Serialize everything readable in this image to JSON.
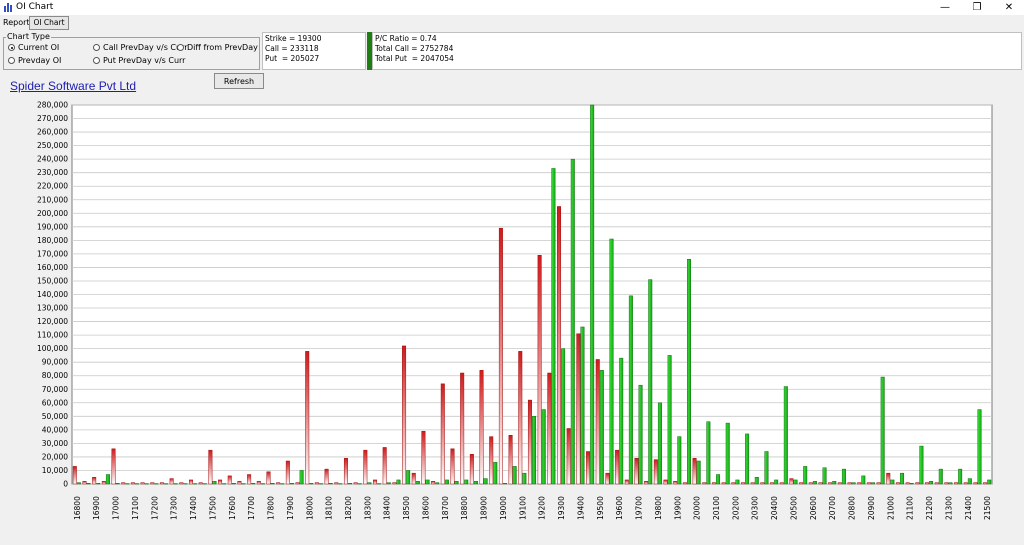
{
  "window": {
    "title": "OI Chart",
    "minimize": "—",
    "restore": "❐",
    "close": "✕"
  },
  "tabs": {
    "report": "Report",
    "oi_chart": "OI Chart"
  },
  "chart_type": {
    "legend": "Chart Type",
    "options": [
      "Current OI",
      "Prevday OI",
      "Call PrevDay v/s Curr",
      "Put PrevDay v/s Curr",
      "Diff from PrevDay"
    ],
    "selected": "Current OI"
  },
  "info_strike": {
    "strike": "Strike = 19300",
    "call": "Call = 233118",
    "put": "Put  = 205027"
  },
  "info_totals": {
    "pc_ratio": "P/C Ratio = 0.74",
    "total_call": "Total Call = 2752784",
    "total_put": "Total Put  = 2047054"
  },
  "refresh_label": "Refresh",
  "company_link": "Spider Software Pvt Ltd",
  "colors": {
    "call": "#22d322",
    "put": "#d42020",
    "plot_bg": "#ffffff",
    "grid": "#c8c8c8"
  },
  "chart_data": {
    "type": "bar",
    "title": "",
    "xlabel": "",
    "ylabel": "",
    "ylim": [
      0,
      280000
    ],
    "ytick_step": 10000,
    "grid": true,
    "categories": [
      "16800",
      "16850",
      "16900",
      "16950",
      "17000",
      "17050",
      "17100",
      "17150",
      "17200",
      "17250",
      "17300",
      "17350",
      "17400",
      "17450",
      "17500",
      "17550",
      "17600",
      "17650",
      "17700",
      "17750",
      "17800",
      "17850",
      "17900",
      "17950",
      "18000",
      "18050",
      "18100",
      "18150",
      "18200",
      "18250",
      "18300",
      "18350",
      "18400",
      "18450",
      "18500",
      "18550",
      "18600",
      "18650",
      "18700",
      "18750",
      "18800",
      "18850",
      "18900",
      "18950",
      "19000",
      "19050",
      "19100",
      "19150",
      "19200",
      "19250",
      "19300",
      "19350",
      "19400",
      "19450",
      "19500",
      "19550",
      "19600",
      "19650",
      "19700",
      "19750",
      "19800",
      "19850",
      "19900",
      "19950",
      "20000",
      "20050",
      "20100",
      "20150",
      "20200",
      "20250",
      "20300",
      "20350",
      "20400",
      "20450",
      "20500",
      "20550",
      "20600",
      "20650",
      "20700",
      "20750",
      "20800",
      "20850",
      "20900",
      "20950",
      "21000",
      "21050",
      "21100",
      "21150",
      "21200",
      "21250",
      "21300",
      "21350",
      "21400",
      "21450",
      "21500"
    ],
    "tick_labels": [
      "16800",
      "16900",
      "17000",
      "17100",
      "17200",
      "17300",
      "17400",
      "17500",
      "17600",
      "17700",
      "17800",
      "17900",
      "18000",
      "18100",
      "18200",
      "18300",
      "18400",
      "18500",
      "18600",
      "18700",
      "18800",
      "18900",
      "19000",
      "19100",
      "19200",
      "19300",
      "19400",
      "19500",
      "19600",
      "19700",
      "19800",
      "19900",
      "20000",
      "20100",
      "20200",
      "20300",
      "20400",
      "20500",
      "20600",
      "20700",
      "20800",
      "20900",
      "21000",
      "21100",
      "21200",
      "21300",
      "21400",
      "21500"
    ],
    "series": [
      {
        "name": "Call",
        "values": [
          1000,
          500,
          500,
          7000,
          500,
          300,
          300,
          300,
          300,
          300,
          300,
          300,
          300,
          300,
          2000,
          300,
          500,
          300,
          500,
          300,
          500,
          300,
          500,
          10000,
          500,
          300,
          500,
          300,
          500,
          300,
          1000,
          300,
          1000,
          3000,
          10000,
          2000,
          3000,
          1000,
          3000,
          2000,
          3000,
          2000,
          4000,
          16000,
          500,
          13000,
          8000,
          50000,
          55000,
          233118,
          100000,
          240000,
          116000,
          280000,
          84000,
          181000,
          93000,
          139000,
          73000,
          151000,
          60000,
          95000,
          35000,
          166000,
          17000,
          46000,
          7000,
          45000,
          3000,
          37000,
          5000,
          24000,
          3000,
          72000,
          3000,
          13000,
          2000,
          12000,
          2000,
          11000,
          1000,
          6000,
          1000,
          79000,
          3000,
          8000,
          500,
          28000,
          2000,
          11000,
          1000,
          11000,
          4000,
          55000,
          3000
        ]
      },
      {
        "name": "Put",
        "values": [
          13000,
          2000,
          5000,
          2000,
          26000,
          1000,
          1000,
          1000,
          1000,
          1000,
          4000,
          1000,
          3000,
          1000,
          25000,
          3000,
          6000,
          2000,
          7000,
          2000,
          9000,
          1000,
          17000,
          1000,
          98000,
          1000,
          11000,
          1000,
          19000,
          1000,
          25000,
          3000,
          27000,
          1000,
          102000,
          8000,
          39000,
          2000,
          74000,
          26000,
          82000,
          22000,
          84000,
          35000,
          189000,
          36000,
          98000,
          62000,
          169000,
          82000,
          205027,
          41000,
          111000,
          24000,
          92000,
          8000,
          25000,
          3000,
          19000,
          2000,
          18000,
          3000,
          2000,
          1000,
          19000,
          1000,
          1000,
          1000,
          1000,
          1000,
          1000,
          1000,
          1000,
          1000,
          4000,
          1000,
          1000,
          1000,
          1000,
          1000,
          1000,
          1000,
          1000,
          1000,
          8000,
          1000,
          1000,
          1000,
          1000,
          1000,
          1000,
          1000,
          1000,
          1000,
          1000
        ]
      }
    ]
  }
}
